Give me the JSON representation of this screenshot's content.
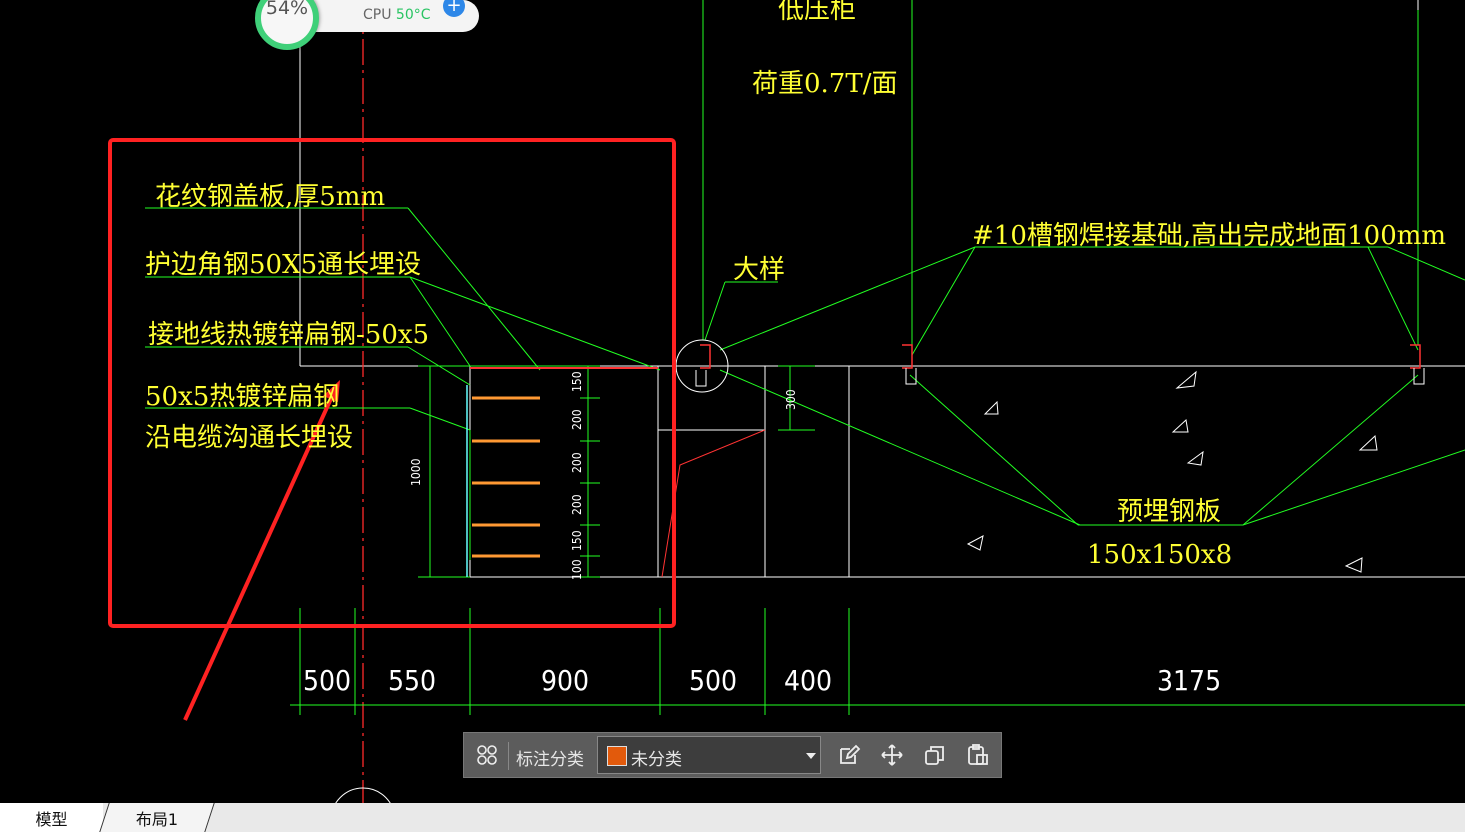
{
  "perf_widget": {
    "load_percent": "54%",
    "cpu_label": "CPU",
    "cpu_temp": "50°C",
    "icon": "plus-icon"
  },
  "drawing": {
    "top_labels": {
      "cabinet": "低压柜",
      "load": "荷重0.7T/面"
    },
    "left_labels": [
      "花纹钢盖板,厚5mm",
      "护边角钢50X5通长埋设",
      "接地线热镀锌扁钢-50x5",
      "50x5热镀锌扁钢",
      "沿电缆沟通长埋设"
    ],
    "detail_label": "大样",
    "channel_label": "#10槽钢焊接基础,高出完成地面100mm",
    "plate_label_line1": "预埋钢板",
    "plate_label_line2": "150x150x8",
    "vertical_dims": [
      "150",
      "200",
      "200",
      "200",
      "150",
      "100"
    ],
    "trench_depth": "1000",
    "step_height": "300",
    "bottom_dims": [
      "500",
      "550",
      "900",
      "500",
      "400",
      "3175"
    ],
    "colors": {
      "background": "#000000",
      "text": "#ffff33",
      "dim_lines": "#22ff22",
      "outline": "#ffffff",
      "highlight_box": "#ff2222",
      "cable_tray": "#ff9933"
    }
  },
  "annotation_toolbar": {
    "category_label": "标注分类",
    "category_value": "未分类",
    "swatch_color": "#e25a0c",
    "tools": [
      "grid-icon",
      "edit-icon",
      "move-icon",
      "copy-icon",
      "paste-icon"
    ]
  },
  "tabs": [
    {
      "label": "模型",
      "active": true
    },
    {
      "label": "布局1",
      "active": false
    }
  ]
}
